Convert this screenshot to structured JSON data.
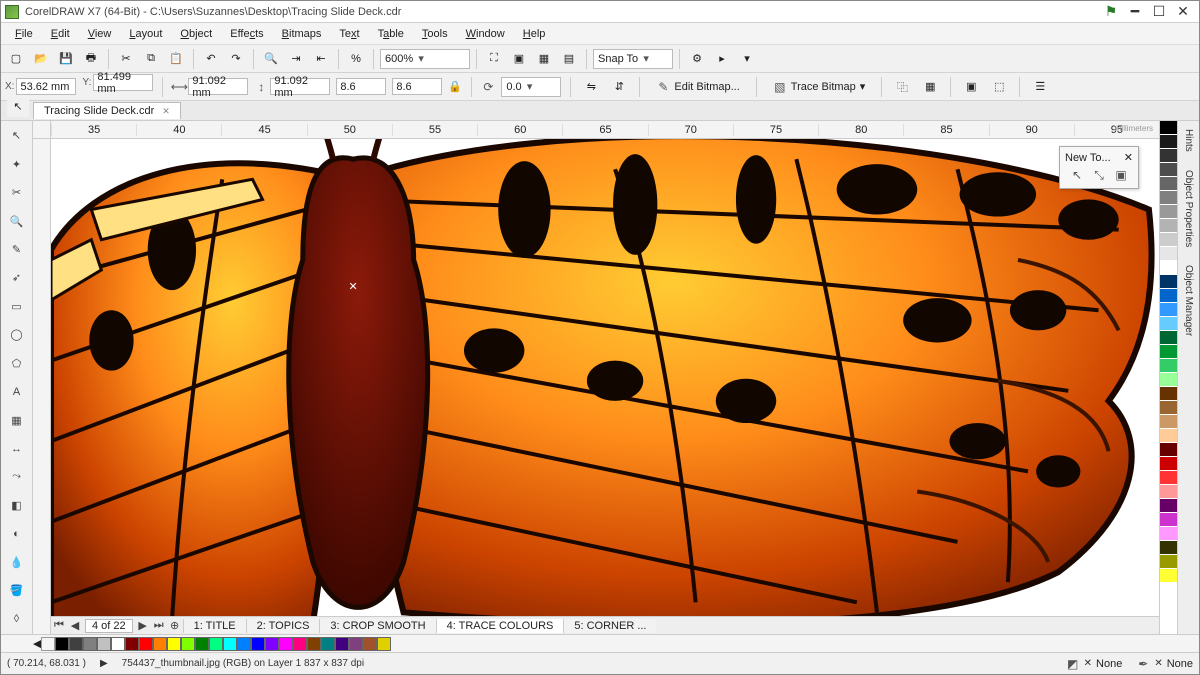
{
  "title": "CorelDRAW X7 (64-Bit) - C:\\Users\\Suzannes\\Desktop\\Tracing Slide Deck.cdr",
  "menu": [
    "File",
    "Edit",
    "View",
    "Layout",
    "Object",
    "Effects",
    "Bitmaps",
    "Text",
    "Table",
    "Tools",
    "Window",
    "Help"
  ],
  "zoom": "600%",
  "snap_label": "Snap To",
  "coords": {
    "x": "53.62 mm",
    "y": "81.499 mm",
    "w": "91.092 mm",
    "h": "91.092 mm",
    "sx": "8.6",
    "sy": "8.6",
    "rot": "0.0"
  },
  "btn_edit_bitmap": "Edit Bitmap...",
  "btn_trace_bitmap": "Trace Bitmap",
  "doc_tab": "Tracing Slide Deck.cdr",
  "ruler_marks": [
    "35",
    "40",
    "45",
    "50",
    "55",
    "60",
    "65",
    "70",
    "75",
    "80",
    "85",
    "90",
    "95"
  ],
  "ruler_unit": "millimeters",
  "new_to": "New To...",
  "page_nav": {
    "current": "4 of 22"
  },
  "page_tabs": [
    "1: TITLE",
    "2: TOPICS",
    "3: CROP SMOOTH",
    "4: TRACE COLOURS",
    "5: CORNER ..."
  ],
  "mini_palette": [
    "#000000",
    "#404040",
    "#808080",
    "#c0c0c0",
    "#ffffff",
    "#800000",
    "#ff0000",
    "#ff8000",
    "#ffff00",
    "#80ff00",
    "#008000",
    "#00ff80",
    "#00ffff",
    "#0080ff",
    "#0000ff",
    "#8000ff",
    "#ff00ff",
    "#ff0080",
    "#804000",
    "#008080",
    "#400080",
    "#804080",
    "#a0522d",
    "#e0d000"
  ],
  "status": {
    "cursor": "( 70.214, 68.031 )",
    "object": "754437_thumbnail.jpg (RGB) on Layer 1 837 x 837 dpi",
    "fill": "None",
    "outline": "None"
  },
  "dock_tabs": [
    "Hints",
    "Object Properties",
    "Object Manager"
  ],
  "palette": [
    "#000000",
    "#1a1a1a",
    "#333333",
    "#4d4d4d",
    "#666666",
    "#808080",
    "#999999",
    "#b3b3b3",
    "#cccccc",
    "#e6e6e6",
    "#ffffff",
    "#003366",
    "#0066cc",
    "#3399ff",
    "#66ccff",
    "#006633",
    "#009933",
    "#33cc66",
    "#99ff99",
    "#663300",
    "#996633",
    "#cc9966",
    "#ffcc99",
    "#660000",
    "#cc0000",
    "#ff3333",
    "#ff9999",
    "#660066",
    "#cc33cc",
    "#ff99ff",
    "#333300",
    "#999900",
    "#ffff33"
  ]
}
